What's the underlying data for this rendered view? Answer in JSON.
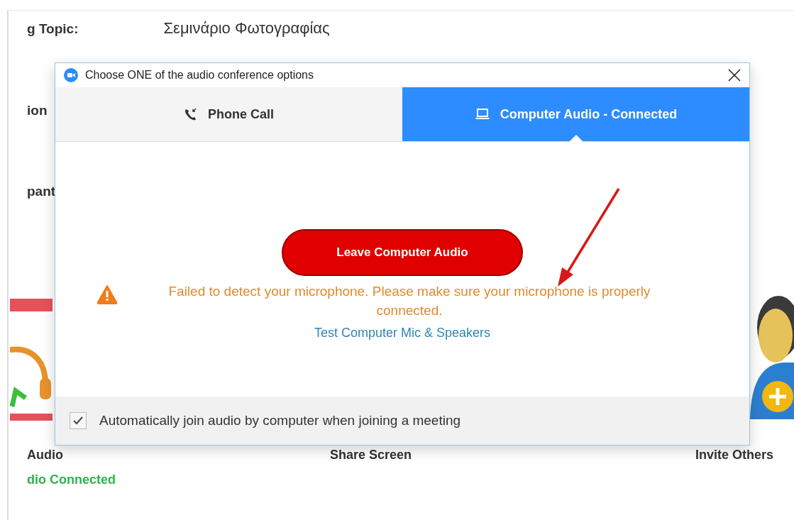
{
  "background_window": {
    "topic_label": "g Topic:",
    "topic": "Σεμινάριο Φωτογραφίας",
    "labels": [
      "ion",
      "pant"
    ],
    "actions": [
      "Audio",
      "Share Screen",
      "Invite Others"
    ],
    "audio_status": "dio Connected"
  },
  "dialog": {
    "title": "Choose ONE of the audio conference options",
    "tabs": [
      {
        "label": "Phone Call",
        "kind": "phone",
        "selected": false
      },
      {
        "label": "Computer Audio - Connected",
        "kind": "computer",
        "selected": true
      }
    ],
    "leave_button": "Leave Computer Audio",
    "warning": "Failed to detect your microphone. Please make sure your microphone is properly connected.",
    "test_link": "Test Computer Mic & Speakers",
    "auto_join": {
      "label": "Automatically join audio by computer when joining a meeting",
      "checked": true
    }
  }
}
